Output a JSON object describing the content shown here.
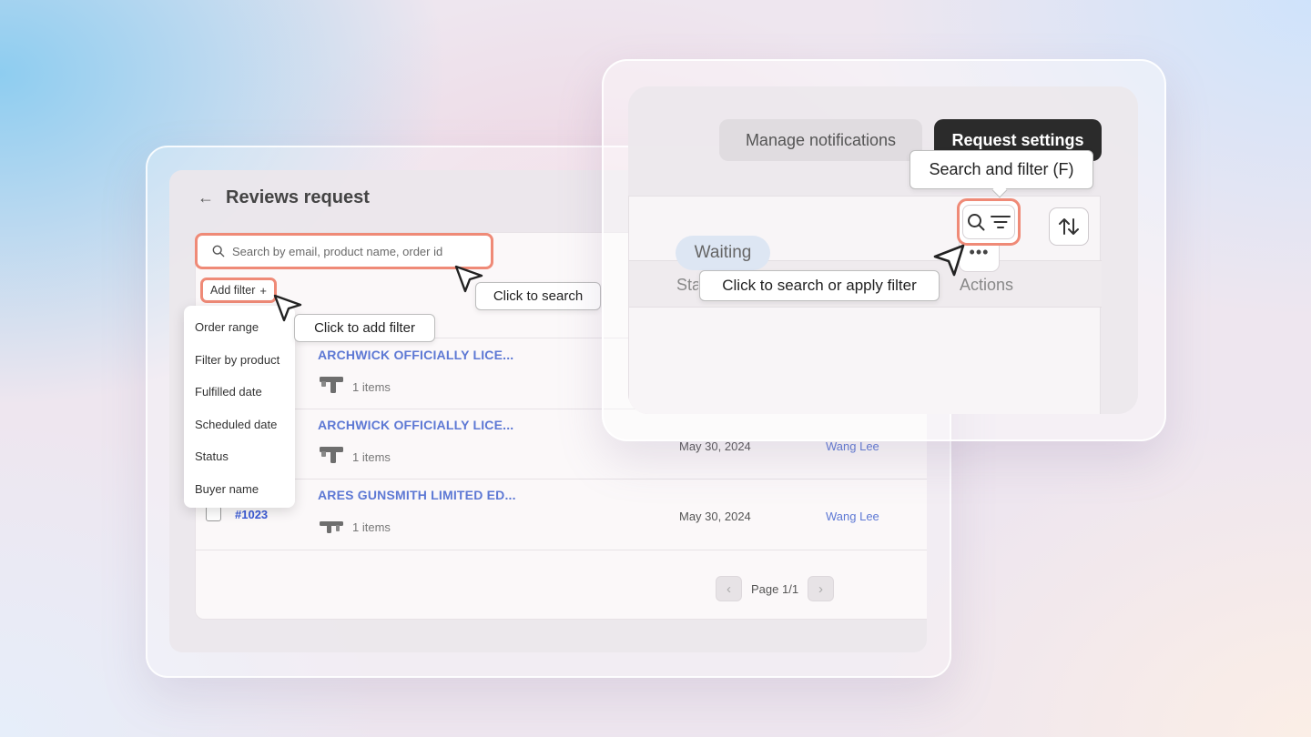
{
  "reviews_panel": {
    "back_icon": "arrow-left-icon",
    "title": "Reviews request",
    "search": {
      "placeholder": "Search by email, product name, order id",
      "value": ""
    },
    "add_filter_label": "Add filter",
    "filter_menu": [
      "Order range",
      "Filter by product",
      "Fulfilled date",
      "Scheduled date",
      "Status",
      "Buyer name"
    ],
    "rows": [
      {
        "order_id": "",
        "product": "ARCHWICK OFFICIALLY LICE...",
        "items": "1 items",
        "date": "",
        "buyer": ""
      },
      {
        "order_id": "",
        "product": "ARCHWICK OFFICIALLY LICE...",
        "items": "1 items",
        "date": "May 30, 2024",
        "buyer": "Wang Lee"
      },
      {
        "order_id": "#1023",
        "product": "ARES GUNSMITH LIMITED ED...",
        "items": "1 items",
        "date": "May 30, 2024",
        "buyer": "Wang Lee"
      }
    ],
    "pagination": {
      "label": "Page 1/1",
      "prev_icon": "chevron-left-icon",
      "next_icon": "chevron-right-icon"
    }
  },
  "tooltips": {
    "search": "Click to search",
    "add_filter": "Click to add filter",
    "search_filter_shortcut": "Search and filter (F)",
    "search_or_filter": "Click to search or apply filter"
  },
  "settings_panel": {
    "manage_notifications": "Manage notifications",
    "request_settings": "Request settings",
    "columns": {
      "status": "Status",
      "actions": "Actions"
    },
    "status_value": "Waiting",
    "more_label": "•••",
    "search_filter_icons": [
      "search-icon",
      "filter-lines-icon"
    ],
    "sort_icon": "sort-arrows-icon"
  },
  "colors": {
    "highlight": "#ef8a77",
    "link": "#5d78d4",
    "primary_button": "#2b2b2b",
    "status_pill": "#dde6f3"
  }
}
